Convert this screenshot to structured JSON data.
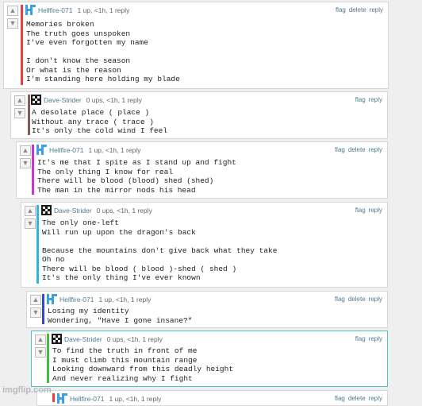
{
  "vote_icons": {
    "up": "arrow-up-icon",
    "down": "arrow-down-icon"
  },
  "action_labels": {
    "flag": "flag",
    "delete": "delete",
    "reply": "reply"
  },
  "colors": {
    "red": "#e0413b",
    "brown": "#8b5a52",
    "magenta": "#c537c9",
    "cyan": "#2fb6e0",
    "blue": "#3446d6",
    "green": "#3fc13f",
    "link": "#4e7a8e"
  },
  "comments": [
    {
      "username": "Hellfire-071",
      "stats": "1 up, <1h, 1 reply",
      "avatar": "hellfire-logo-icon",
      "body": "Memories broken\nThe truth goes unspoken\nI've even forgotten my name\n\nI don't know the season\nOr what is the reason\nI'm standing here holding my blade",
      "actions": [
        "flag",
        "delete",
        "reply"
      ]
    },
    {
      "username": "Dave-Strider",
      "stats": "0 ups, <1h, 1 reply",
      "avatar": "dave-strider-avatar-icon",
      "body": "A desolate place ( place )\nWithout any trace ( trace )\nIt's only the cold wind I feel",
      "actions": [
        "flag",
        "reply"
      ]
    },
    {
      "username": "Hellfire-071",
      "stats": "1 up, <1h, 1 reply",
      "avatar": "hellfire-logo-icon",
      "body": "It's me that I spite as I stand up and fight\nThe only thing I know for real\nThere will be blood (blood) shed (shed)\nThe man in the mirror nods his head",
      "actions": [
        "flag",
        "delete",
        "reply"
      ]
    },
    {
      "username": "Dave-Strider",
      "stats": "0 ups, <1h, 1 reply",
      "avatar": "dave-strider-avatar-icon",
      "body": "The only one-left\nWill run up upon the dragon's back\n\nBecause the mountains don't give back what they take\nOh no\nThere will be blood ( blood )-shed ( shed )\nIt's the only thing I've ever known",
      "actions": [
        "flag",
        "reply"
      ]
    },
    {
      "username": "Hellfire-071",
      "stats": "1 up, <1h, 1 reply",
      "avatar": "hellfire-logo-icon",
      "body": "Losing my identity\nWondering, \"Have I gone insane?\"",
      "actions": [
        "flag",
        "delete",
        "reply"
      ]
    },
    {
      "username": "Dave-Strider",
      "stats": "0 ups, <1h, 1 reply",
      "avatar": "dave-strider-avatar-icon",
      "body": "To find the truth in front of me\nI must climb this mountain range\nLooking downward from this deadly height\nAnd never realizing why I fight",
      "actions": [
        "flag",
        "reply"
      ]
    },
    {
      "username": "Hellfire-071",
      "stats": "1 up, <1h, 1 reply",
      "avatar": "hellfire-logo-icon",
      "body": "",
      "actions": [
        "flag",
        "delete",
        "reply"
      ]
    }
  ],
  "watermark": "imgflip.com"
}
